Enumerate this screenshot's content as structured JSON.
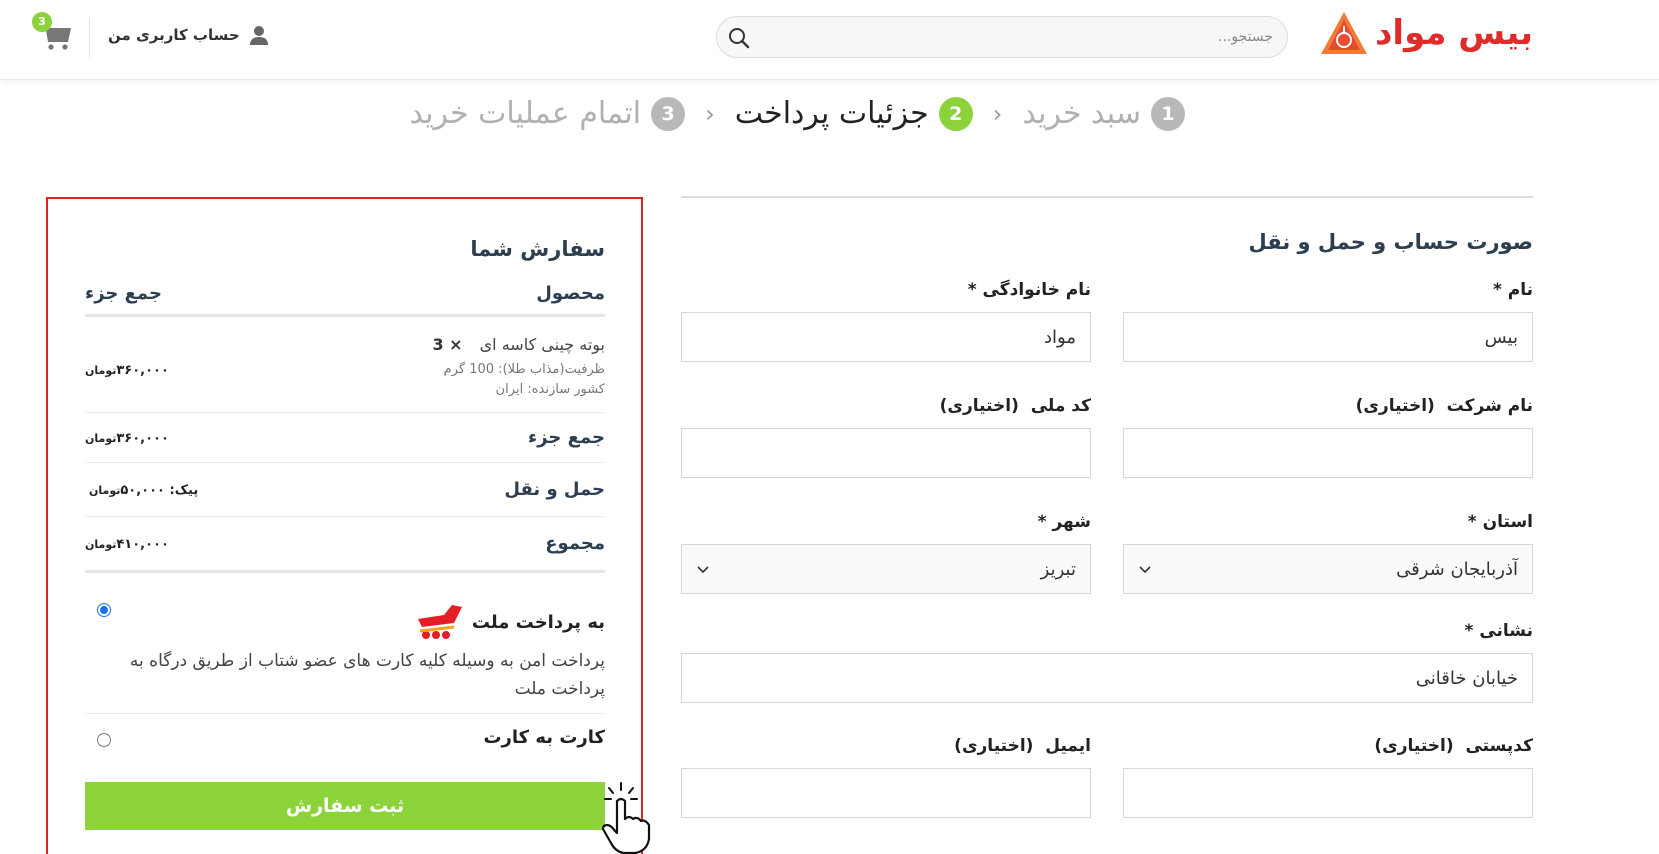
{
  "header": {
    "logo_text": "بیس مواد",
    "search_placeholder": "جستجو...",
    "account_label": "حساب کاربری من",
    "cart_count": "3",
    "brand_color": "#e02b2b",
    "accent_color": "#8bd23b"
  },
  "steps": [
    {
      "num": "1",
      "label": "سبد خرید",
      "state": "done"
    },
    {
      "num": "2",
      "label": "جزئیات پرداخت",
      "state": "active"
    },
    {
      "num": "3",
      "label": "اتمام عملیات خرید",
      "state": "pending"
    }
  ],
  "billing": {
    "title": "صورت حساب و حمل و نقل",
    "first_name": {
      "label": "نام",
      "req": "*",
      "value": "بیس"
    },
    "last_name": {
      "label": "نام خانوادگی",
      "req": "*",
      "value": "مواد"
    },
    "company": {
      "label": "نام شرکت",
      "optional": "(اختیاری)",
      "value": ""
    },
    "national_code": {
      "label": "کد ملی",
      "optional": "(اختیاری)",
      "value": ""
    },
    "province": {
      "label": "استان",
      "req": "*",
      "value": "آذربایجان شرقی"
    },
    "city": {
      "label": "شهر",
      "req": "*",
      "value": "تبریز"
    },
    "address": {
      "label": "نشانی",
      "req": "*",
      "value": "خیابان خاقانی"
    },
    "postcode": {
      "label": "کدپستی",
      "optional": "(اختیاری)",
      "value": ""
    },
    "email": {
      "label": "ایمیل",
      "optional": "(اختیاری)",
      "value": ""
    }
  },
  "order": {
    "title": "سفارش شما",
    "col_product": "محصول",
    "col_subtotal": "جمع جزء",
    "item": {
      "name": "بوته چینی کاسه ای",
      "qty": "× 3",
      "meta1": "ظرفیت(مذاب طلا): 100 گرم",
      "meta2": "کشور سازنده: ایران",
      "price": "۳۶۰,۰۰۰",
      "currency": "تومان"
    },
    "subtotal": {
      "label": "جمع جزء",
      "value": "۳۶۰,۰۰۰",
      "currency": "تومان"
    },
    "shipping": {
      "label": "حمل و نقل",
      "method": "پیک:",
      "value": "۵۰,۰۰۰",
      "currency": "تومان"
    },
    "total": {
      "label": "مجموع",
      "value": "۴۱۰,۰۰۰",
      "currency": "تومان"
    },
    "pay_mellat": {
      "label": "به پرداخت ملت",
      "desc": "پرداخت امن به وسیله کلیه کارت های عضو شتاب از طریق درگاه به پرداخت ملت"
    },
    "pay_card": {
      "label": "کارت به کارت"
    },
    "submit_label": "ثبت سفارش"
  }
}
